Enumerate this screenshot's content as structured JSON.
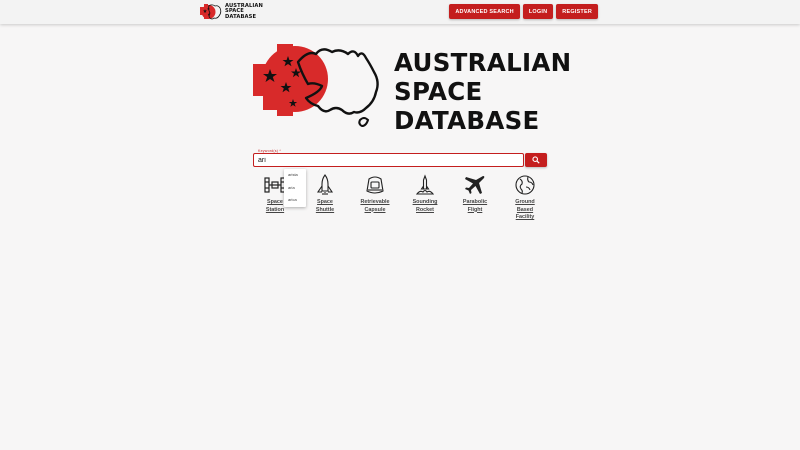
{
  "brand": {
    "name": "AUSTRALIAN\nSPACE\nDATABASE"
  },
  "nav": {
    "advanced_search": "ADVANCED SEARCH",
    "login": "LOGIN",
    "register": "REGISTER"
  },
  "hero": {
    "title": "AUSTRALIAN\nSPACE\nDATABASE"
  },
  "search": {
    "label": "Keyword(s) *",
    "value": "ari",
    "suggestions": [
      "arista",
      "aria",
      "arica"
    ]
  },
  "categories": [
    {
      "label": "Space\nStation",
      "icon": "space-station-icon"
    },
    {
      "label": "Space\nShuttle",
      "icon": "space-shuttle-icon"
    },
    {
      "label": "Retrievable\nCapsule",
      "icon": "capsule-icon"
    },
    {
      "label": "Sounding\nRocket",
      "icon": "sounding-rocket-icon"
    },
    {
      "label": "Parabolic\nFlight",
      "icon": "airplane-icon"
    },
    {
      "label": "Ground\nBased\nFacility",
      "icon": "globe-icon"
    }
  ],
  "colors": {
    "accent": "#c41e1e",
    "background": "#f7f6f6"
  }
}
